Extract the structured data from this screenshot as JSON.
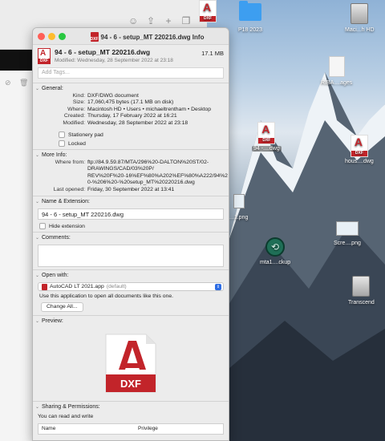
{
  "finder": {
    "toolbar_icons": [
      "smiley-icon",
      "share-icon",
      "plus-icon",
      "copy-icon"
    ]
  },
  "info": {
    "title": "94 - 6 - setup_MT 220216.dwg Info",
    "file_name": "94 - 6 - setup_MT 220216.dwg",
    "file_size": "17.1 MB",
    "modified_header": "Modified: Wednesday, 28 September 2022 at 23:18",
    "tags_placeholder": "Add Tags...",
    "icon_badge": "DXF",
    "general": {
      "heading": "General:",
      "rows": [
        {
          "k": "Kind:",
          "v": "DXF/DWG document"
        },
        {
          "k": "Size:",
          "v": "17,060,475 bytes (17.1 MB on disk)"
        },
        {
          "k": "Where:",
          "v": "Macintosh HD • Users • michaeltrentham • Desktop"
        },
        {
          "k": "Created:",
          "v": "Thursday, 17 February 2022 at 16:21"
        },
        {
          "k": "Modified:",
          "v": "Wednesday, 28 September 2022 at 23:18"
        }
      ],
      "stationery": "Stationery pad",
      "locked": "Locked"
    },
    "more_info": {
      "heading": "More Info:",
      "where_from_label": "Where from:",
      "where_from": [
        "ftp://84.9.59.87/MTA/296%20-DALTON%20ST/02-",
        "DRAWINGS/CAD/03%20P/",
        "REV%20F%20-16%EF%80%A202%EF%80%A222/94%2",
        "0-%206%20-%20setup_MT%20220216.dwg"
      ],
      "last_opened_label": "Last opened:",
      "last_opened": "Friday, 30 September 2022 at 13:41"
    },
    "name_ext": {
      "heading": "Name & Extension:",
      "value": "94 - 6 - setup_MT 220216.dwg",
      "hide_ext": "Hide extension"
    },
    "comments": {
      "heading": "Comments:"
    },
    "open_with": {
      "heading": "Open with:",
      "app": "AutoCAD LT 2021.app",
      "app_note": "(default)",
      "text": "Use this application to open all documents like this one.",
      "button": "Change All..."
    },
    "preview": {
      "heading": "Preview:",
      "badge": "DXF"
    },
    "sharing": {
      "heading": "Sharing & Permissions:",
      "text": "You can read and write",
      "col_name": "Name",
      "col_priv": "Privilege"
    }
  },
  "desktop": {
    "icons": [
      {
        "label": "P18 2023",
        "type": "folder"
      },
      {
        "label": "Maci...h HD",
        "type": "drive"
      },
      {
        "label": "RIBA....ages",
        "type": "doc"
      },
      {
        "label": "94 -....dwg",
        "type": "dxf"
      },
      {
        "label": "hous....dwg",
        "type": "dxf"
      },
      {
        "label": "...1.png",
        "type": "image"
      },
      {
        "label": "Scre....png",
        "type": "screenshot"
      },
      {
        "label": "mta1....ckup",
        "type": "timemachine"
      },
      {
        "label": "Transcend",
        "type": "drive"
      }
    ]
  }
}
